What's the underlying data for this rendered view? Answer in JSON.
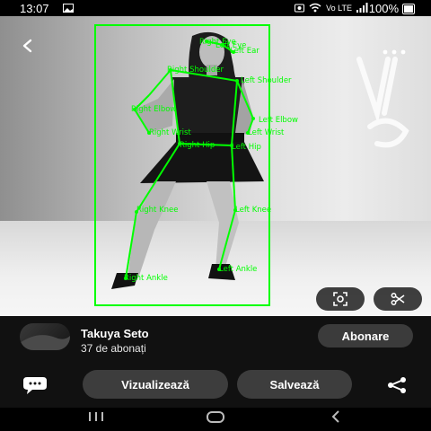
{
  "status_bar": {
    "time": "13:07",
    "network": "Vo LTE",
    "battery": "100%"
  },
  "photo": {
    "pose_labels": {
      "right_eye": "Right Eye",
      "left_eye": "Left Eye",
      "left_ear": "Left Ear",
      "right_shoulder": "Right Shoulder",
      "left_shoulder": "Left Shoulder",
      "right_elbow": "Right Elbow",
      "left_elbow": "Left Elbow",
      "right_wrist": "Right Wrist",
      "left_wrist": "Left Wrist",
      "right_hip": "Right Hip",
      "left_hip": "Left Hip",
      "right_knee": "Right Knee",
      "left_knee": "Left Knee",
      "right_ankle": "Right Ankle",
      "left_ankle": "Left Ankle"
    },
    "overlay_color": "#00ff00"
  },
  "profile": {
    "name": "Takuya Seto",
    "subscribers": "37 de abonați",
    "subscribe_label": "Abonare"
  },
  "actions": {
    "view_label": "Vizualizează",
    "save_label": "Salvează"
  },
  "icons": {
    "back": "back-arrow-icon",
    "more": "more-options-icon",
    "lens": "visual-search-icon",
    "cut": "scissors-icon",
    "comment": "comment-icon",
    "share": "share-icon"
  }
}
